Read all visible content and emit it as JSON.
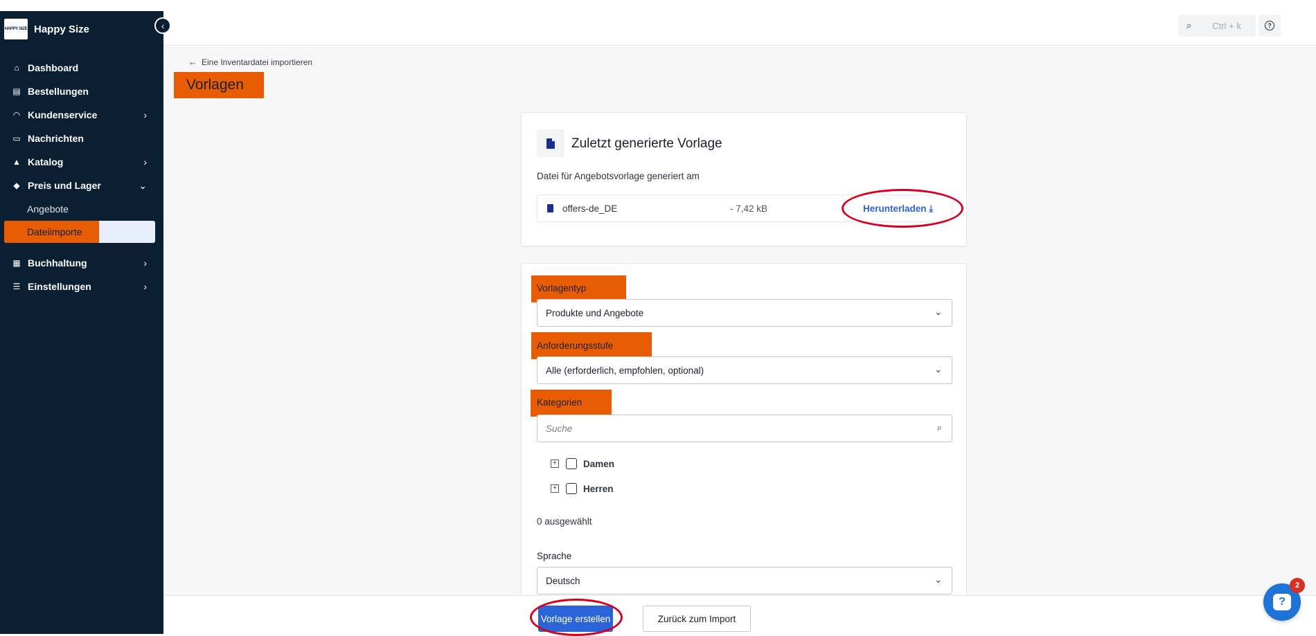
{
  "sidebar": {
    "brand_logo": "HAPPY SIZE",
    "brand_name": "Happy Size",
    "items": [
      {
        "label": "Dashboard",
        "icon": "home-icon"
      },
      {
        "label": "Bestellungen",
        "icon": "clipboard-icon"
      },
      {
        "label": "Kundenservice",
        "icon": "headset-icon"
      },
      {
        "label": "Nachrichten",
        "icon": "message-icon"
      },
      {
        "label": "Katalog",
        "icon": "shapes-icon"
      },
      {
        "label": "Preis und Lager",
        "icon": "tag-icon"
      },
      {
        "label": "Buchhaltung",
        "icon": "invoice-icon"
      },
      {
        "label": "Einstellungen",
        "icon": "sliders-icon"
      }
    ],
    "sub_items": [
      "Angebote",
      "Dateiimporte"
    ]
  },
  "topbar": {
    "search_shortcut": "Ctrl + k"
  },
  "page": {
    "breadcrumb": "Eine Inventardatei importieren",
    "title": "Vorlagen"
  },
  "recent": {
    "title": "Zuletzt generierte Vorlage",
    "subtitle": "Datei für Angebotsvorlage generiert am",
    "file_name": "offers-de_DE",
    "file_size": "- 7,42 kB",
    "download_label": "Herunterladen"
  },
  "form": {
    "template_type_label": "Vorlagentyp",
    "template_type_value": "Produkte und Angebote",
    "requirement_label": "Anforderungsstufe",
    "requirement_value": "Alle (erforderlich, empfohlen, optional)",
    "categories_label": "Kategorien",
    "required_mark": "*",
    "search_placeholder": "Suche",
    "categories": [
      "Damen",
      "Herren"
    ],
    "selected_count": "0 ausgewählt",
    "language_label": "Sprache",
    "language_value": "Deutsch"
  },
  "footer": {
    "primary_label": "Vorlage erstellen",
    "secondary_label": "Zurück zum Import"
  },
  "chat": {
    "badge": "2"
  },
  "colors": {
    "sidebar_bg": "#0b1f33",
    "accent": "#2b63d9",
    "highlight": "#e85d04",
    "annotation_ring": "#d5001c"
  }
}
